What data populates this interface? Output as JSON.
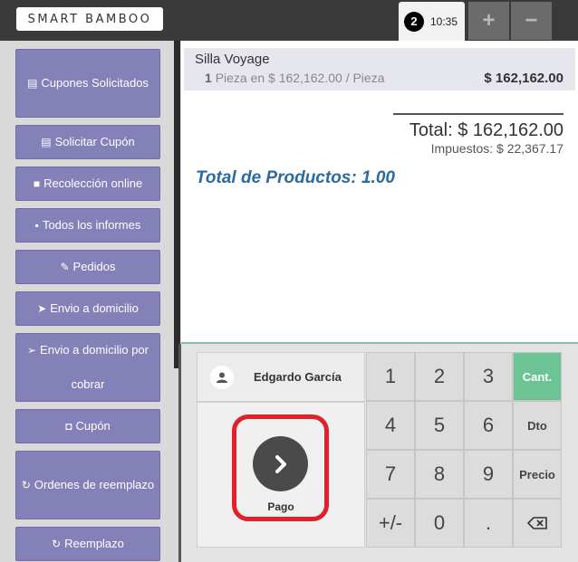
{
  "header": {
    "logo_text": "SMART BAMBOO",
    "order_number": "2",
    "order_time": "10:35",
    "add_label": "+",
    "remove_label": "−"
  },
  "sidebar": {
    "items": [
      {
        "label": "Cupones Solicitados",
        "icon": "coupon-icon"
      },
      {
        "label": "Solicitar Cupón",
        "icon": "coupon-icon"
      },
      {
        "label": "Recolección online",
        "icon": "shopping-bag-icon"
      },
      {
        "label": "Todos los informes",
        "icon": "report-icon"
      },
      {
        "label": "Pedidos",
        "icon": "paperclip-icon"
      },
      {
        "label": "Envio a domicilio",
        "icon": "paper-plane-icon"
      },
      {
        "label": "Envio a domicilio por cobrar",
        "icon": "paper-plane-outline-icon"
      },
      {
        "label": "Cupón",
        "icon": "gift-icon"
      },
      {
        "label": "Ordenes de reemplazo",
        "icon": "refresh-icon"
      },
      {
        "label": "Reemplazo",
        "icon": "refresh-icon"
      }
    ]
  },
  "ticket": {
    "line": {
      "product": "Silla Voyage",
      "qty": "1",
      "detail": "Pieza en $ 162,162.00 / Pieza",
      "price": "$ 162,162.00"
    },
    "total": "Total: $ 162,162.00",
    "taxes": "Impuestos: $ 22,367.17",
    "total_products": "Total de Productos: 1.00"
  },
  "payment": {
    "customer_name": "Edgardo García",
    "pay_label": "Pago"
  },
  "keypad": {
    "k1": "1",
    "k2": "2",
    "k3": "3",
    "k4": "4",
    "k5": "5",
    "k6": "6",
    "k7": "7",
    "k8": "8",
    "k9": "9",
    "kpm": "+/-",
    "k0": "0",
    "kdot": ".",
    "mode_qty": "Cant.",
    "mode_disc": "Dto",
    "mode_price": "Precio"
  },
  "colors": {
    "sidebar_button": "#8481b8",
    "active_mode": "#6cc495",
    "highlight": "#e0202a",
    "total_products": "#2a6aa0"
  }
}
